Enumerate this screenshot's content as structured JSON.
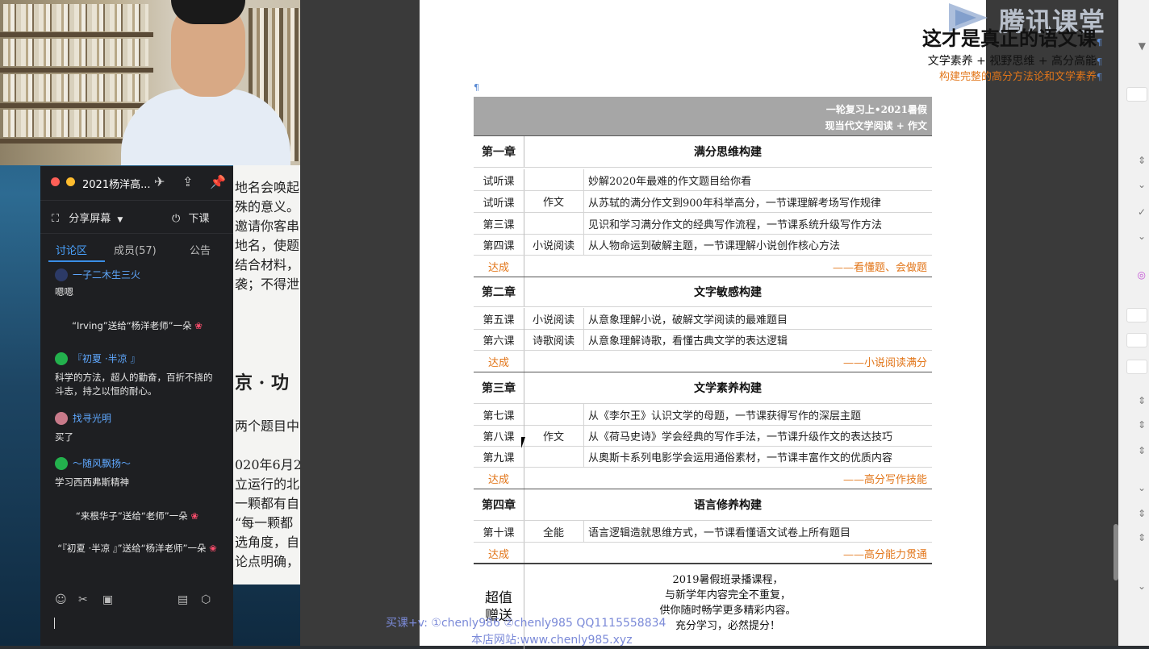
{
  "chat": {
    "title": "2021杨洋高...",
    "share_label": "分享屏幕",
    "end_class_label": "下课",
    "tabs": [
      {
        "label": "讨论区"
      },
      {
        "label": "成员(57)"
      },
      {
        "label": "公告"
      }
    ],
    "messages": [
      {
        "user": "一子二木生三火",
        "text": "嗯嗯"
      },
      {
        "gift": "“Irving”送给“杨洋老师”一朵"
      },
      {
        "user": "『初夏 ·半凉 』",
        "text": "科学的方法，超人的勤奋，百折不挠的斗志，持之以恒的耐心。"
      },
      {
        "user": "找寻光明",
        "text": "买了"
      },
      {
        "user": "～随风飘扬～",
        "text": "学习西西弗斯精神"
      },
      {
        "gift": "“来根华子”送给“老师”一朵"
      },
      {
        "gift": "“『初夏 ·半凉 』”送给“杨洋老师”一朵"
      }
    ]
  },
  "behind_doc": {
    "lines": [
      "地名会唤起",
      "殊的意义。",
      "邀请你客串",
      "地名，使题",
      "结合材料，",
      "袭；不得泄"
    ],
    "heading": "京 · 功",
    "lines2": [
      "两个题目中",
      "020年6月23",
      "立运行的北",
      "一颗都有自",
      "“每一颗都",
      "选角度，自",
      "论点明确，"
    ]
  },
  "logo": {
    "text": "腾讯课堂"
  },
  "syllabus": {
    "title": "这才是真正的语文课",
    "subtitle1": "文学素养 + 视野思维 + 高分高能",
    "subtitle2": "构建完整的高分方法论和文学素养",
    "header_line1": "一轮复习上•2021暑假",
    "header_line2": "现当代文学阅读 + 作文",
    "dacheng": "达成",
    "chapters": [
      {
        "name": "第一章",
        "title": "满分思维构建",
        "lessons": [
          {
            "no": "试听课",
            "desc": "妙解2020年最难的作文题目给你看"
          },
          {
            "no": "试听课",
            "desc": "从苏轼的满分作文到900年科举高分，一节课理解考场写作规律"
          },
          {
            "no": "第三课",
            "desc": "见识和学习满分作文的经典写作流程，一节课系统升级写作方法"
          },
          {
            "no": "第四课",
            "desc": "从人物命运到破解主题，一节课理解小说创作核心方法"
          }
        ],
        "types": [
          {
            "label": "作文"
          },
          {
            "label": "小说阅读"
          }
        ],
        "goal": "——看懂题、会做题"
      },
      {
        "name": "第二章",
        "title": "文字敏感构建",
        "lessons": [
          {
            "no": "第五课",
            "desc": "从意象理解小说，破解文学阅读的最难题目"
          },
          {
            "no": "第六课",
            "desc": "从意象理解诗歌，看懂古典文学的表达逻辑"
          }
        ],
        "types": [
          {
            "label": "小说阅读"
          },
          {
            "label": "诗歌阅读"
          }
        ],
        "goal": "——小说阅读满分"
      },
      {
        "name": "第三章",
        "title": "文学素养构建",
        "lessons": [
          {
            "no": "第七课",
            "desc": "从《李尔王》认识文学的母题，一节课获得写作的深层主题"
          },
          {
            "no": "第八课",
            "desc": "从《荷马史诗》学会经典的写作手法，一节课升级作文的表达技巧"
          },
          {
            "no": "第九课",
            "desc": "从奥斯卡系列电影学会运用通俗素材，一节课丰富作文的优质内容"
          }
        ],
        "types": [
          {
            "label": "作文"
          }
        ],
        "goal": "——高分写作技能"
      },
      {
        "name": "第四章",
        "title": "语言修养构建",
        "lessons": [
          {
            "no": "第十课",
            "desc": "语言逻辑造就思维方式，一节课看懂语文试卷上所有题目"
          }
        ],
        "types": [
          {
            "label": "全能"
          }
        ],
        "goal": "——高分能力贯通"
      }
    ],
    "bonus": {
      "label": "超值赠送",
      "lines": [
        "2019暑假班录播课程，",
        "与新学年内容完全不重复，",
        "供你随时畅学更多精彩内容。",
        "充分学习，必然提分！"
      ]
    }
  },
  "watermark": {
    "line1": "买课+v: ①chenly986 ②chenly985 QQ1115558834",
    "line2": "本店网站:www.chenly985.xyz"
  }
}
